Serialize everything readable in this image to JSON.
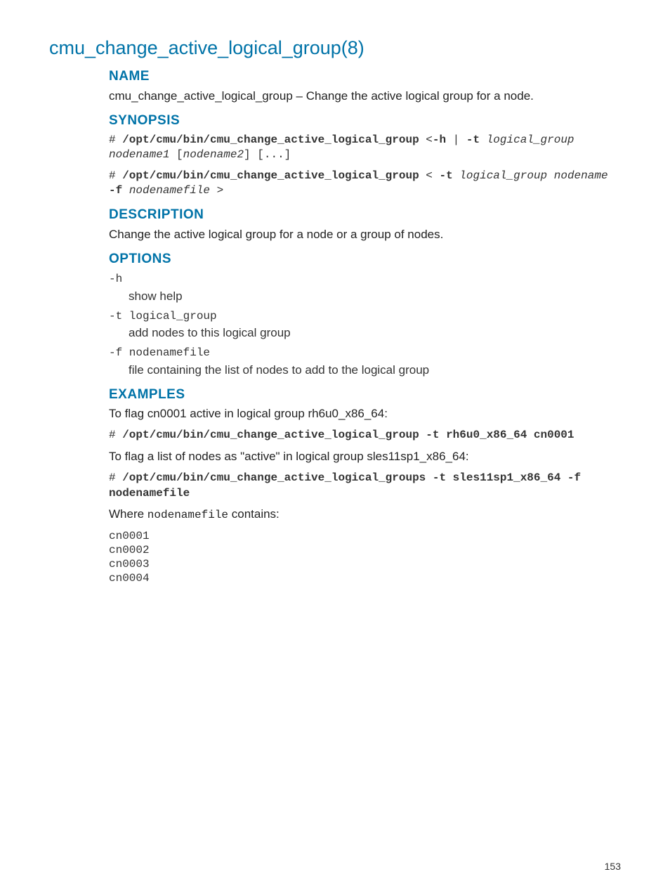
{
  "title": "cmu_change_active_logical_group(8)",
  "sections": {
    "name": {
      "heading": "NAME",
      "text_cmd": "cmu_change_active_logical_group",
      "text_sep": " – ",
      "text_desc": "Change the active logical group for a node."
    },
    "synopsis": {
      "heading": "SYNOPSIS",
      "line1": {
        "hash": "# ",
        "cmd": "/opt/cmu/bin/cmu_change_active_logical_group",
        "post1": " <",
        "flag_h": "-h",
        "pipe": " | ",
        "flag_t": "-t",
        "sp": " ",
        "arg_lg": "logical_group",
        "arg_n1": "nodename1",
        "lb": " [",
        "arg_n2": "nodename2",
        "rb": "]",
        "dots": " [...]"
      },
      "line2": {
        "hash": "# ",
        "cmd": "/opt/cmu/bin/cmu_change_active_logical_group",
        "post1": " < ",
        "flag_t": "-t",
        "sp": " ",
        "arg_lg": "logical_group",
        "sp2": " ",
        "arg_node": "nodename",
        "flag_f": "-f",
        "sp3": " ",
        "arg_file": "nodenamefile",
        "close": " >"
      }
    },
    "description": {
      "heading": "DESCRIPTION",
      "text": "Change the active logical group for a node or a group of nodes."
    },
    "options": {
      "heading": "OPTIONS",
      "items": [
        {
          "term": "-h",
          "desc": "show help"
        },
        {
          "term": "-t logical_group",
          "desc": "add nodes to this logical group"
        },
        {
          "term": "-f nodenamefile",
          "desc": "file containing the list of nodes to add to the logical group"
        }
      ]
    },
    "examples": {
      "heading": "EXAMPLES",
      "intro1": "To flag cn0001 active in logical group rh6u0_x86_64:",
      "cmd1_hash": "# ",
      "cmd1": "/opt/cmu/bin/cmu_change_active_logical_group -t rh6u0_x86_64 cn0001",
      "intro2": "To flag a list of nodes as \"active\" in logical group sles11sp1_x86_64:",
      "cmd2_hash": "# ",
      "cmd2": "/opt/cmu/bin/cmu_change_active_logical_groups -t sles11sp1_x86_64 -f nodenamefile",
      "where_pre": "Where ",
      "where_file": "nodenamefile",
      "where_post": " contains:",
      "filecontents": "cn0001\ncn0002\ncn0003\ncn0004"
    }
  },
  "pagenum": "153"
}
